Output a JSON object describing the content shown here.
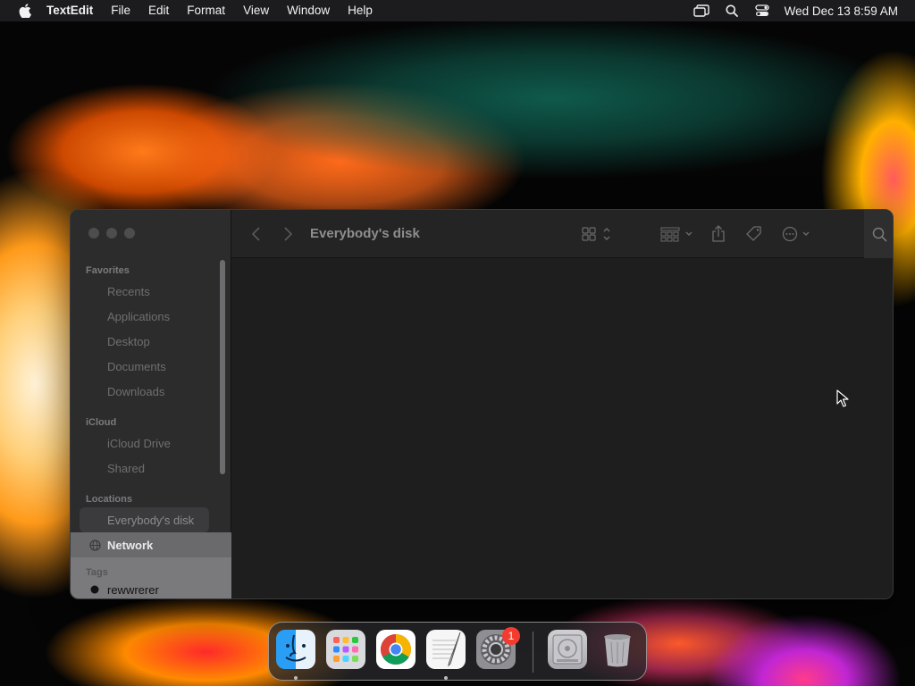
{
  "menubar": {
    "app_name": "TextEdit",
    "menus": [
      "File",
      "Edit",
      "Format",
      "View",
      "Window",
      "Help"
    ],
    "clock": "Wed Dec 13  8:59 AM",
    "status_icons": [
      "screen-mirroring-icon",
      "spotlight-icon",
      "control-center-icon"
    ]
  },
  "finder": {
    "title": "Everybody's disk",
    "sidebar": {
      "favorites_header": "Favorites",
      "favorites": [
        "Recents",
        "Applications",
        "Desktop",
        "Documents",
        "Downloads"
      ],
      "icloud_header": "iCloud",
      "icloud": [
        "iCloud Drive",
        "Shared"
      ],
      "locations_header": "Locations",
      "locations": [
        "Everybody's disk",
        "Network"
      ],
      "tags_header": "Tags",
      "tags": [
        "rewwrerer"
      ]
    },
    "toolbar_icons": [
      "back-icon",
      "forward-icon",
      "view-mode-icon",
      "group-icon",
      "share-icon",
      "tag-icon",
      "more-actions-icon",
      "search-icon"
    ]
  },
  "dock": {
    "apps": [
      "Finder",
      "Launchpad",
      "Google Chrome",
      "TextEdit",
      "System Settings",
      "Disk",
      "Trash"
    ],
    "settings_badge": "1"
  },
  "colors": {
    "menubar_bg": "#1c1c1e",
    "window_bg": "#1e1e1e",
    "sidebar_bg": "#2c2c2d",
    "badge": "#f33b2f"
  }
}
